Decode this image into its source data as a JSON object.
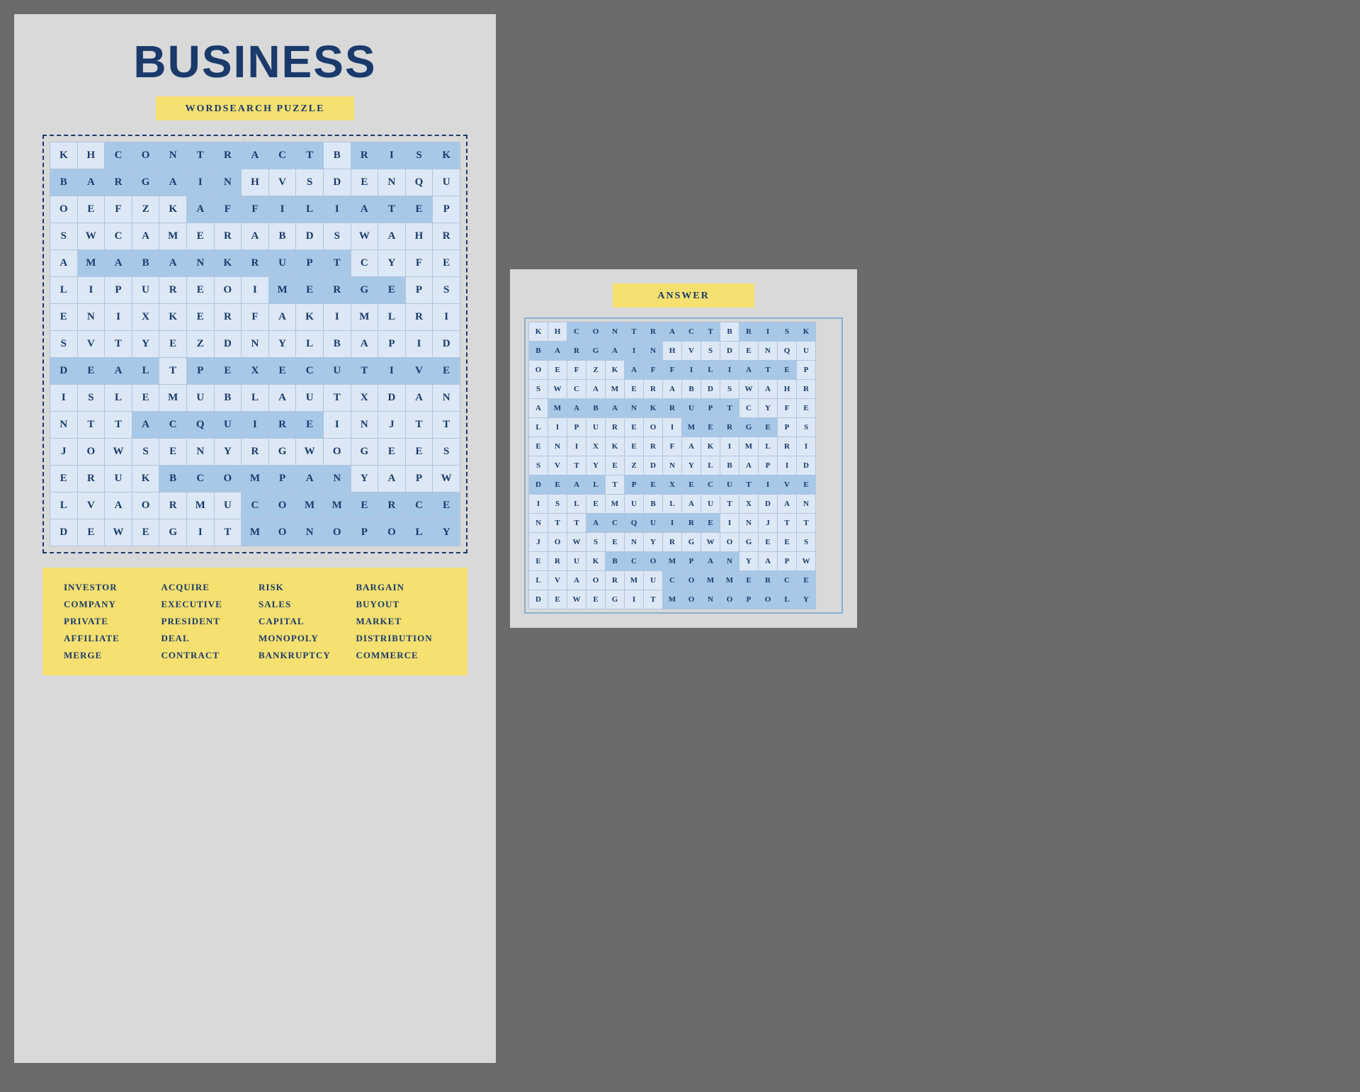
{
  "leftPanel": {
    "title": "BUSINESS",
    "subtitle": "WORDSEARCH PUZZLE",
    "wordList": [
      "INVESTOR",
      "ACQUIRE",
      "RISK",
      "BARGAIN",
      "COMPANY",
      "EXECUTIVE",
      "SALES",
      "BUYOUT",
      "PRIVATE",
      "PRESIDENT",
      "CAPITAL",
      "MARKET",
      "AFFILIATE",
      "DEAL",
      "MONOPOLY",
      "DISTRIBUTION",
      "MERGE",
      "CONTRACT",
      "BANKRUPTCY",
      "COMMERCE"
    ],
    "grid": [
      [
        "K",
        "H",
        "C",
        "O",
        "N",
        "T",
        "R",
        "A",
        "C",
        "T",
        "B",
        "R",
        "I",
        "S",
        "K"
      ],
      [
        "B",
        "A",
        "R",
        "G",
        "A",
        "I",
        "N",
        "H",
        "V",
        "S",
        "D",
        "E",
        "N",
        "Q",
        "U"
      ],
      [
        "O",
        "E",
        "F",
        "Z",
        "K",
        "A",
        "F",
        "F",
        "I",
        "L",
        "I",
        "A",
        "T",
        "E",
        "P"
      ],
      [
        "S",
        "W",
        "C",
        "A",
        "M",
        "E",
        "R",
        "A",
        "B",
        "D",
        "S",
        "W",
        "A",
        "H",
        "R"
      ],
      [
        "A",
        "M",
        "A",
        "B",
        "A",
        "N",
        "K",
        "R",
        "U",
        "P",
        "T",
        "C",
        "Y",
        "F",
        "E"
      ],
      [
        "L",
        "I",
        "P",
        "U",
        "R",
        "E",
        "O",
        "I",
        "M",
        "E",
        "R",
        "G",
        "E",
        "P",
        "S"
      ],
      [
        "E",
        "N",
        "I",
        "X",
        "K",
        "E",
        "R",
        "F",
        "A",
        "K",
        "I",
        "M",
        "L",
        "R",
        "I"
      ],
      [
        "S",
        "V",
        "T",
        "Y",
        "E",
        "Z",
        "D",
        "N",
        "Y",
        "L",
        "B",
        "A",
        "P",
        "I",
        "D"
      ],
      [
        "D",
        "E",
        "A",
        "L",
        "T",
        "P",
        "E",
        "X",
        "E",
        "C",
        "U",
        "T",
        "I",
        "V",
        "E"
      ],
      [
        "I",
        "S",
        "L",
        "E",
        "M",
        "U",
        "B",
        "L",
        "A",
        "U",
        "T",
        "X",
        "D",
        "A",
        "N"
      ],
      [
        "N",
        "T",
        "T",
        "A",
        "C",
        "Q",
        "U",
        "I",
        "R",
        "E",
        "I",
        "N",
        "J",
        "T",
        "T"
      ],
      [
        "J",
        "O",
        "W",
        "S",
        "E",
        "N",
        "Y",
        "R",
        "G",
        "W",
        "O",
        "G",
        "E",
        "E",
        "S"
      ],
      [
        "E",
        "R",
        "U",
        "K",
        "B",
        "C",
        "O",
        "M",
        "P",
        "A",
        "N",
        "Y",
        "A",
        "P",
        "W"
      ],
      [
        "L",
        "V",
        "A",
        "O",
        "R",
        "M",
        "U",
        "C",
        "O",
        "M",
        "M",
        "E",
        "R",
        "C",
        "E"
      ],
      [
        "D",
        "E",
        "W",
        "E",
        "G",
        "I",
        "T",
        "M",
        "O",
        "N",
        "O",
        "P",
        "O",
        "L",
        "Y"
      ]
    ],
    "highlights": {
      "CONTRACT": [
        [
          0,
          2
        ],
        [
          0,
          3
        ],
        [
          0,
          4
        ],
        [
          0,
          5
        ],
        [
          0,
          6
        ],
        [
          0,
          7
        ],
        [
          0,
          8
        ],
        [
          0,
          9
        ]
      ],
      "RISK": [
        [
          0,
          11
        ],
        [
          0,
          12
        ],
        [
          0,
          13
        ],
        [
          0,
          14
        ]
      ],
      "BARGAIN": [
        [
          1,
          0
        ],
        [
          1,
          1
        ],
        [
          1,
          2
        ],
        [
          1,
          3
        ],
        [
          1,
          4
        ],
        [
          1,
          5
        ],
        [
          1,
          6
        ]
      ],
      "AFFILIATE": [
        [
          2,
          5
        ],
        [
          2,
          6
        ],
        [
          2,
          7
        ],
        [
          2,
          8
        ],
        [
          2,
          9
        ],
        [
          2,
          10
        ],
        [
          2,
          11
        ],
        [
          2,
          12
        ],
        [
          2,
          13
        ]
      ],
      "BANKRUPTCY": [
        [
          4,
          1
        ],
        [
          4,
          2
        ],
        [
          4,
          3
        ],
        [
          4,
          4
        ],
        [
          4,
          5
        ],
        [
          4,
          6
        ],
        [
          4,
          7
        ],
        [
          4,
          8
        ],
        [
          4,
          9
        ],
        [
          4,
          10
        ]
      ],
      "MERGE": [
        [
          5,
          8
        ],
        [
          5,
          9
        ],
        [
          5,
          10
        ],
        [
          5,
          11
        ],
        [
          5,
          12
        ]
      ],
      "DEAL": [
        [
          8,
          0
        ],
        [
          8,
          1
        ],
        [
          8,
          2
        ],
        [
          8,
          3
        ]
      ],
      "EXECUTIVE": [
        [
          8,
          5
        ],
        [
          8,
          6
        ],
        [
          8,
          7
        ],
        [
          8,
          8
        ],
        [
          8,
          9
        ],
        [
          8,
          10
        ],
        [
          8,
          11
        ],
        [
          8,
          12
        ],
        [
          8,
          13
        ]
      ],
      "ACQUIRE": [
        [
          10,
          3
        ],
        [
          10,
          4
        ],
        [
          10,
          5
        ],
        [
          10,
          6
        ],
        [
          10,
          7
        ],
        [
          10,
          8
        ],
        [
          10,
          9
        ]
      ],
      "COMPANY": [
        [
          12,
          4
        ],
        [
          12,
          5
        ],
        [
          12,
          6
        ],
        [
          12,
          7
        ],
        [
          12,
          8
        ],
        [
          12,
          9
        ],
        [
          12,
          10
        ]
      ],
      "COMMERCE": [
        [
          13,
          7
        ],
        [
          13,
          8
        ],
        [
          13,
          9
        ],
        [
          13,
          10
        ],
        [
          13,
          11
        ],
        [
          13,
          12
        ],
        [
          13,
          13
        ],
        [
          13,
          14
        ]
      ],
      "MONOPOLY": [
        [
          14,
          7
        ],
        [
          14,
          8
        ],
        [
          14,
          9
        ],
        [
          14,
          10
        ],
        [
          14,
          11
        ],
        [
          14,
          12
        ],
        [
          14,
          13
        ],
        [
          14,
          14
        ]
      ],
      "CAPITAL": [
        [
          5,
          0
        ]
      ],
      "SALES": [],
      "INVESTOR": [],
      "PRIVATE": [],
      "MARKET": [],
      "BUYOUT": [],
      "DISTRIBUTION": [],
      "PRESIDENT": []
    }
  },
  "rightPanel": {
    "answerTitle": "ANSWER"
  }
}
